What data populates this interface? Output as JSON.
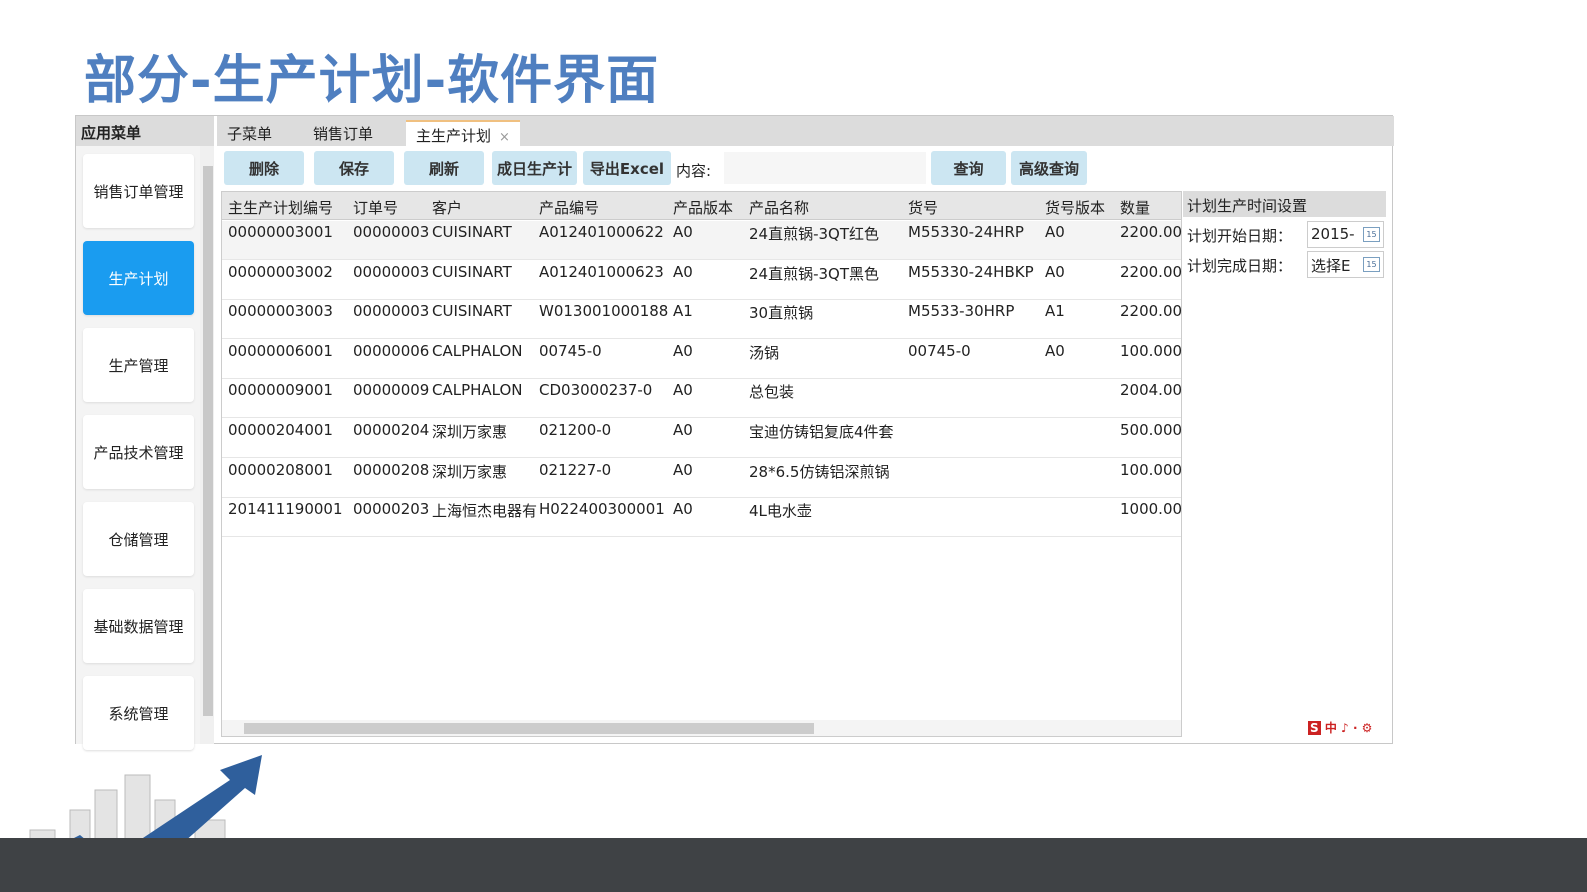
{
  "slide_title": "部分-生产计划-软件界面",
  "sidebar": {
    "header": "应用菜单",
    "items": [
      {
        "label": "销售订单管理",
        "active": false
      },
      {
        "label": "生产计划",
        "active": true
      },
      {
        "label": "生产管理",
        "active": false
      },
      {
        "label": "产品技术管理",
        "active": false
      },
      {
        "label": "仓储管理",
        "active": false
      },
      {
        "label": "基础数据管理",
        "active": false
      },
      {
        "label": "系统管理",
        "active": false
      }
    ]
  },
  "tabs": [
    {
      "label": "子菜单"
    },
    {
      "label": "销售订单"
    },
    {
      "label": "主生产计划",
      "close": "×"
    }
  ],
  "toolbar": {
    "delete": "删除",
    "save": "保存",
    "refresh": "刷新",
    "generate": "成日生产计",
    "export": "导出Excel",
    "content_label": "内容:",
    "content_value": "",
    "query": "查询",
    "advanced_query": "高级查询"
  },
  "table": {
    "columns": [
      "主生产计划编号",
      "订单号",
      "客户",
      "产品编号",
      "产品版本",
      "产品名称",
      "货号",
      "货号版本",
      "数量"
    ],
    "rows": [
      [
        "00000003001",
        "00000003",
        "CUISINART",
        "A012401000622",
        "A0",
        "24直煎锅-3QT红色",
        "M55330-24HRP",
        "A0",
        "2200.00"
      ],
      [
        "00000003002",
        "00000003",
        "CUISINART",
        "A012401000623",
        "A0",
        "24直煎锅-3QT黑色",
        "M55330-24HBKP",
        "A0",
        "2200.00"
      ],
      [
        "00000003003",
        "00000003",
        "CUISINART",
        "W013001000188",
        "A1",
        "30直煎锅",
        "M5533-30HRP",
        "A1",
        "2200.00"
      ],
      [
        "00000006001",
        "00000006",
        "CALPHALON",
        "00745-0",
        "A0",
        "汤锅",
        "00745-0",
        "A0",
        "100.000"
      ],
      [
        "00000009001",
        "00000009",
        "CALPHALON",
        "CD03000237-0",
        "A0",
        "总包装",
        "",
        "",
        "2004.00"
      ],
      [
        "00000204001",
        "00000204",
        "深圳万家惠",
        "021200-0",
        "A0",
        "宝迪仿铸铝复底4件套",
        "",
        "",
        "500.000"
      ],
      [
        "00000208001",
        "00000208",
        "深圳万家惠",
        "021227-0",
        "A0",
        "28*6.5仿铸铝深煎锅",
        "",
        "",
        "100.000"
      ],
      [
        "201411190001",
        "00000203",
        "上海恒杰电器有",
        "H022400300001",
        "A0",
        "4L电水壶",
        "",
        "",
        "1000.00"
      ]
    ]
  },
  "panel": {
    "title": "计划生产时间设置",
    "start_label": "计划开始日期：",
    "start_value": "2015-",
    "end_label": "计划完成日期：",
    "end_value": "选择E",
    "calendar_glyph": "15"
  },
  "ime": {
    "items": [
      "中",
      "♪",
      "∙",
      "⚙"
    ]
  },
  "colors": {
    "title": "#4f7fc0",
    "active": "#1a9cf0",
    "button": "#cce6f2",
    "band": "#3f4245"
  }
}
